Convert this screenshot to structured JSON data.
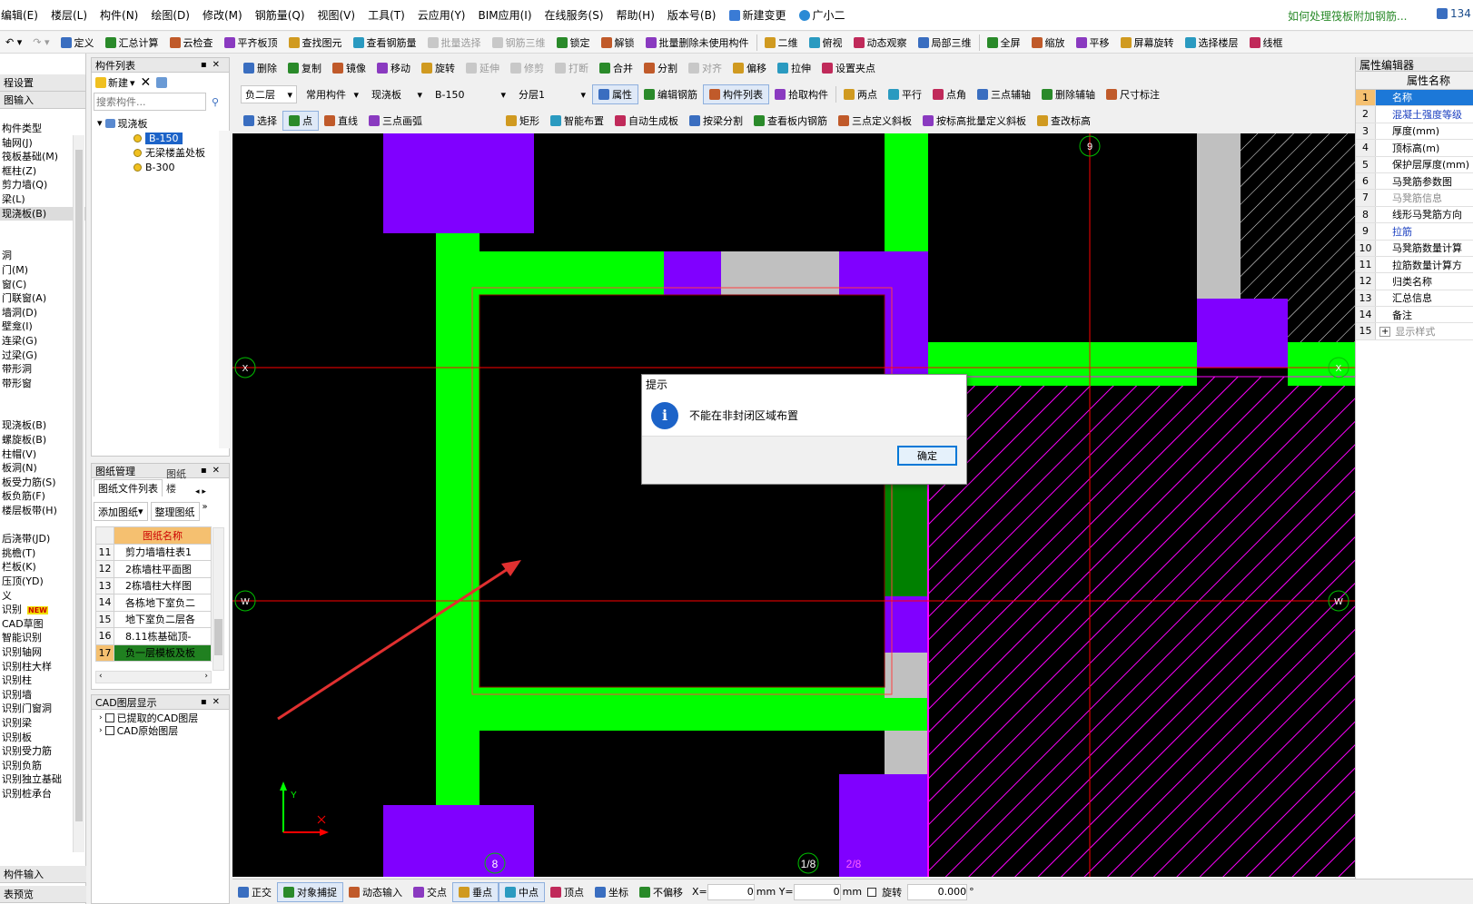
{
  "menu": [
    "编辑(E)",
    "楼层(L)",
    "构件(N)",
    "绘图(D)",
    "修改(M)",
    "钢筋量(Q)",
    "视图(V)",
    "工具(T)",
    "云应用(Y)",
    "BIM应用(I)",
    "在线服务(S)",
    "帮助(H)",
    "版本号(B)",
    "新建变更",
    "广小二"
  ],
  "promo": "如何处理筏板附加钢筋...",
  "user_id": "134",
  "toolbar1": [
    "定义",
    "汇总计算",
    "云检查",
    "平齐板顶",
    "查找图元",
    "查看钢筋量",
    "批量选择",
    "钢筋三维",
    "锁定",
    "解锁",
    "批量删除未使用构件",
    "二维",
    "俯视",
    "动态观察",
    "局部三维",
    "全屏",
    "缩放",
    "平移",
    "屏幕旋转",
    "选择楼层",
    "线框"
  ],
  "toolbar1_disabled": [
    6,
    7
  ],
  "toolbar2": [
    "删除",
    "复制",
    "镜像",
    "移动",
    "旋转",
    "延伸",
    "修剪",
    "打断",
    "合并",
    "分割",
    "对齐",
    "偏移",
    "拉伸",
    "设置夹点"
  ],
  "toolbar3": {
    "floor": "负二层",
    "common": "常用构件",
    "category": "现浇板",
    "element": "B-150",
    "layer": "分层1",
    "buttons": [
      "属性",
      "编辑钢筋",
      "构件列表",
      "拾取构件",
      "两点",
      "平行",
      "点角",
      "三点辅轴",
      "删除辅轴",
      "尺寸标注"
    ]
  },
  "toolbar4": [
    "选择",
    "点",
    "直线",
    "三点画弧",
    "矩形",
    "智能布置",
    "自动生成板",
    "按梁分割",
    "查看板内钢筋",
    "三点定义斜板",
    "按标高批量定义斜板",
    "查改标高"
  ],
  "left_nav": {
    "header1": "程设置",
    "header2": "图输入",
    "items": [
      "构件类型",
      "轴网(J)",
      "筏板基础(M)",
      "框柱(Z)",
      "剪力墙(Q)",
      "梁(L)",
      "现浇板(B)",
      "",
      "",
      "洞",
      "门(M)",
      "窗(C)",
      "门联窗(A)",
      "墙洞(D)",
      "壁龛(I)",
      "连梁(G)",
      "过梁(G)",
      "带形洞",
      "带形窗",
      "",
      "",
      "现浇板(B)",
      "螺旋板(B)",
      "柱帽(V)",
      "板洞(N)",
      "板受力筋(S)",
      "板负筋(F)",
      "楼层板带(H)",
      "",
      "后浇带(JD)",
      "挑檐(T)",
      "栏板(K)",
      "压顶(YD)",
      "义",
      "识别",
      "CAD草图",
      "智能识别",
      "识别轴网",
      "识别柱大样",
      "识别柱",
      "识别墙",
      "识别门窗洞",
      "识别梁",
      "识别板",
      "识别受力筋",
      "识别负筋",
      "识别独立基础",
      "识别桩承台"
    ],
    "highlight": 6,
    "bottom1": "构件输入",
    "bottom2": "表预览",
    "new_badge": "NEW"
  },
  "component_list": {
    "title": "构件列表",
    "new_btn": "新建",
    "search_placeholder": "搜索构件...",
    "tree_root": "现浇板",
    "children": [
      "B-150",
      "无梁楼盖处板",
      "B-300"
    ],
    "selected": 0
  },
  "drawing_mgmt": {
    "title": "图纸管理",
    "tab1": "图纸文件列表",
    "tab2": "图纸楼",
    "add_btn": "添加图纸",
    "organize_btn": "整理图纸",
    "col_header": "图纸名称",
    "rows": [
      {
        "no": "11",
        "name": "剪力墙墙柱表1"
      },
      {
        "no": "12",
        "name": "2栋墙柱平面图"
      },
      {
        "no": "13",
        "name": "2栋墙柱大样图"
      },
      {
        "no": "14",
        "name": "各栋地下室负二"
      },
      {
        "no": "15",
        "name": "地下室负二层各"
      },
      {
        "no": "16",
        "name": "8.11栋基础顶-"
      },
      {
        "no": "17",
        "name": "负一层模板及板"
      }
    ]
  },
  "cad_layers": {
    "title": "CAD图层显示",
    "items": [
      "已提取的CAD图层",
      "CAD原始图层"
    ]
  },
  "prop_editor": {
    "title": "属性编辑器",
    "header": "属性名称",
    "rows": [
      {
        "no": "1",
        "name": "名称",
        "color": "#000000"
      },
      {
        "no": "2",
        "name": "混凝土强度等级",
        "color": "#1a3fc0"
      },
      {
        "no": "3",
        "name": "厚度(mm)",
        "color": "#000000"
      },
      {
        "no": "4",
        "name": "顶标高(m)",
        "color": "#000000"
      },
      {
        "no": "5",
        "name": "保护层厚度(mm)",
        "color": "#000000"
      },
      {
        "no": "6",
        "name": "马凳筋参数图",
        "color": "#000000"
      },
      {
        "no": "7",
        "name": "马凳筋信息",
        "color": "#8a8a8a"
      },
      {
        "no": "8",
        "name": "线形马凳筋方向",
        "color": "#000000"
      },
      {
        "no": "9",
        "name": "拉筋",
        "color": "#1a3fc0"
      },
      {
        "no": "10",
        "name": "马凳筋数量计算",
        "color": "#000000"
      },
      {
        "no": "11",
        "name": "拉筋数量计算方",
        "color": "#000000"
      },
      {
        "no": "12",
        "name": "归类名称",
        "color": "#000000"
      },
      {
        "no": "13",
        "name": "汇总信息",
        "color": "#000000"
      },
      {
        "no": "14",
        "name": "备注",
        "color": "#000000"
      },
      {
        "no": "15",
        "name": "显示样式",
        "color": "#8a8a8a"
      }
    ]
  },
  "canvas_labels": {
    "axis_top": "9",
    "axis_left_x": "X",
    "axis_left_w": "W",
    "axis_right_x": "X",
    "axis_right_w": "W",
    "axis_bottom_1": "8",
    "axis_bottom_2": "1/8",
    "axis_bottom_3": "2/8",
    "ucs_y": "Y"
  },
  "dialog": {
    "title": "提示",
    "message": "不能在非封闭区域布置",
    "ok": "确定"
  },
  "status": {
    "buttons": [
      "正交",
      "对象捕捉",
      "动态输入",
      "交点",
      "垂点",
      "中点",
      "顶点",
      "坐标",
      "不偏移"
    ],
    "x_label": "X=",
    "x_value": "0",
    "y_label": "mm Y=",
    "y_value": "0",
    "unit": "mm",
    "rotate_label": "旋转",
    "rotate_value": "0.000",
    "degree": "°"
  },
  "colors": {
    "green": "#00ff00",
    "purple": "#8000ff",
    "gray": "#c0c0c0",
    "darkgreen": "#008000",
    "axis_red": "#ff0000",
    "magenta": "#ff00ff",
    "arrow": "#e03030"
  }
}
